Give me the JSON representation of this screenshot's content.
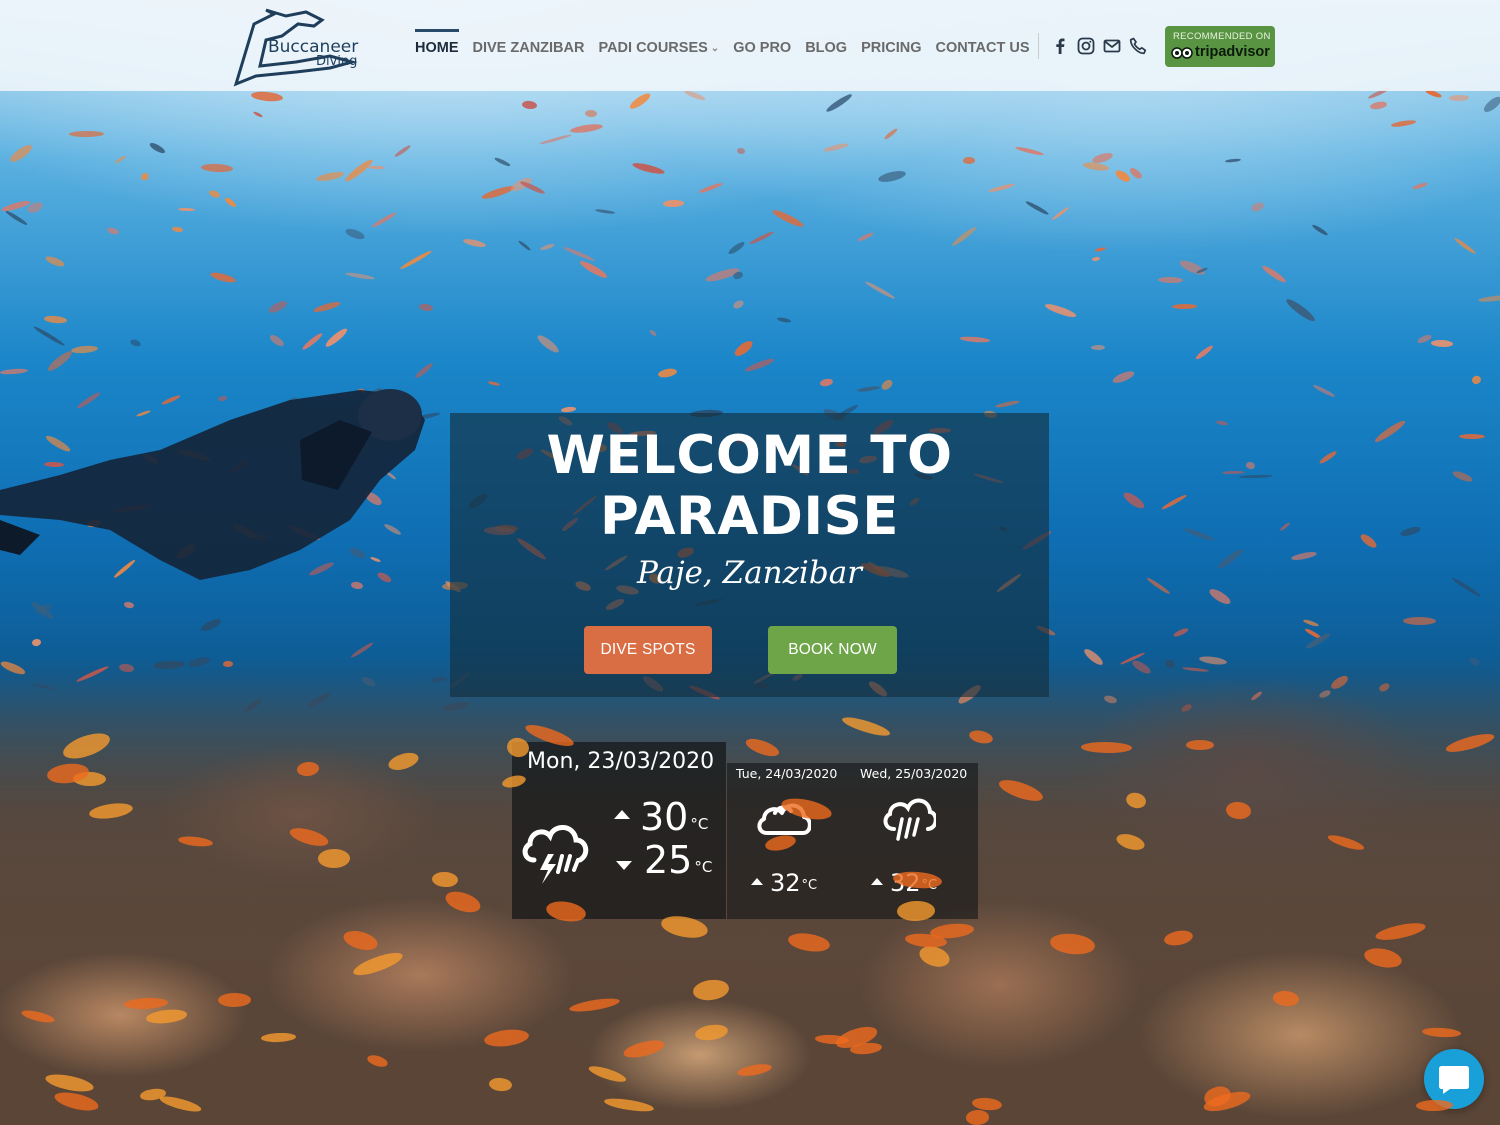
{
  "header": {
    "logo_name": "Buccaneer",
    "logo_sub": "Diving",
    "nav": [
      {
        "label": "HOME",
        "active": true
      },
      {
        "label": "DIVE ZANZIBAR"
      },
      {
        "label": "PADI COURSES",
        "has_dropdown": true
      },
      {
        "label": "GO PRO"
      },
      {
        "label": "BLOG"
      },
      {
        "label": "PRICING"
      },
      {
        "label": "CONTACT US"
      }
    ],
    "social_icons": [
      "facebook-icon",
      "instagram-icon",
      "email-icon",
      "phone-icon"
    ],
    "tripadvisor": {
      "top": "RECOMMENDED ON",
      "name": "tripadvisor",
      "color": "#589442"
    }
  },
  "hero": {
    "title": "WELCOME TO PARADISE",
    "subtitle": "Paje, Zanzibar",
    "buttons": {
      "dive_spots": "DIVE SPOTS",
      "book_now": "BOOK NOW"
    },
    "colors": {
      "dive_spots": "#d96d43",
      "book_now": "#6da548"
    }
  },
  "weather": {
    "today": {
      "date": "Mon, 23/03/2020",
      "icon": "thunderstorm-icon",
      "high": "30",
      "low": "25",
      "unit": "°C"
    },
    "forecast": [
      {
        "date": "Tue, 24/03/2020",
        "icon": "cloudy-icon",
        "high": "32",
        "unit": "°C"
      },
      {
        "date": "Wed, 25/03/2020",
        "icon": "rain-icon",
        "high": "32",
        "unit": "°C"
      }
    ]
  },
  "chat": {
    "icon": "chat-icon",
    "color": "#1aa0d8"
  }
}
